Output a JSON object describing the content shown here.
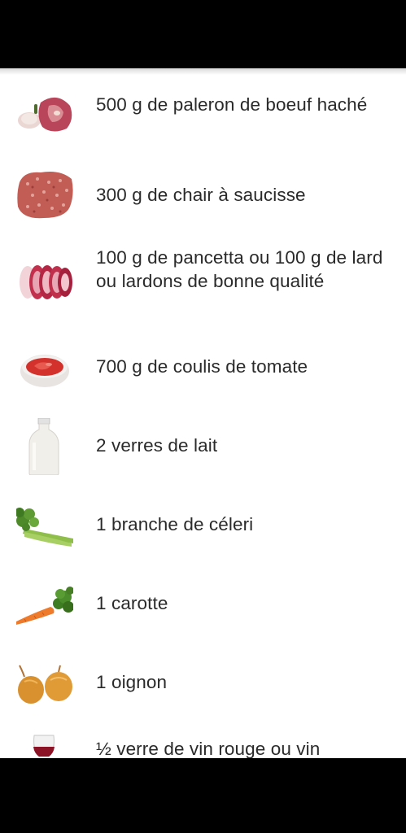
{
  "ingredients": [
    {
      "text": "500 g de paleron de boeuf haché",
      "icon": "beef-icon"
    },
    {
      "text": "300 g de chair à saucisse",
      "icon": "ground-meat-icon"
    },
    {
      "text": "100 g de pancetta ou 100 g de lard ou lardons de bonne qualité",
      "icon": "pancetta-icon"
    },
    {
      "text": "700 g de coulis de tomate",
      "icon": "tomato-sauce-icon"
    },
    {
      "text": "2 verres de lait",
      "icon": "milk-bottle-icon"
    },
    {
      "text": "1 branche de céleri",
      "icon": "celery-icon"
    },
    {
      "text": "1 carotte",
      "icon": "carrot-icon"
    },
    {
      "text": "1 oignon",
      "icon": "onion-icon"
    },
    {
      "text": "½ verre de vin rouge ou vin",
      "icon": "wine-glass-icon"
    }
  ]
}
